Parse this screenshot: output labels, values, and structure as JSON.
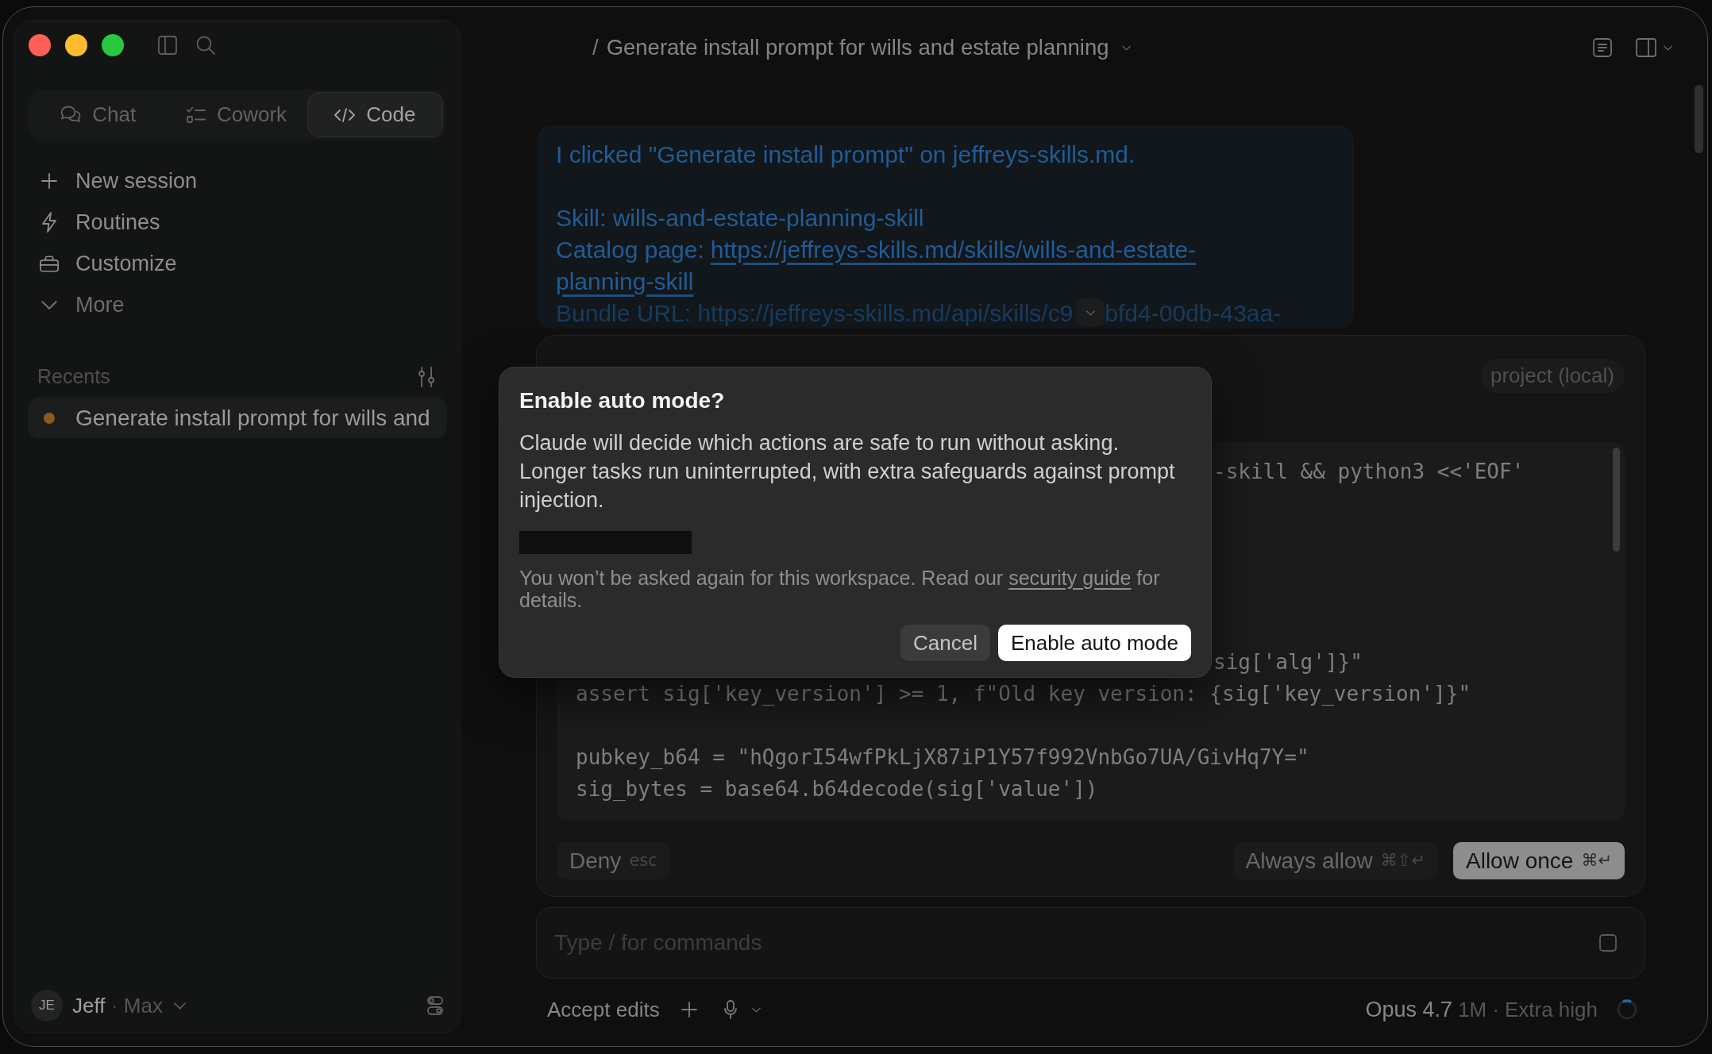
{
  "sidebar": {
    "mode_tabs": [
      {
        "label": "Chat",
        "selected": false
      },
      {
        "label": "Cowork",
        "selected": false
      },
      {
        "label": "Code",
        "selected": true
      }
    ],
    "nav": [
      "New session",
      "Routines",
      "Customize",
      "More"
    ],
    "recents_label": "Recents",
    "recents": [
      {
        "title": "Generate install prompt for wills and",
        "selected": true,
        "color": "#8c5a1e"
      }
    ],
    "user": {
      "initials": "JE",
      "name": "Jeff",
      "separator": "·",
      "plan": "Max"
    }
  },
  "header": {
    "separator": "/",
    "title": "Generate install prompt for wills and estate planning"
  },
  "message": {
    "intro": "I clicked \"Generate install prompt\" on jeffreys-skills.md.",
    "skill": "Skill: wills-and-estate-planning-skill",
    "catalog_label": "Catalog page:",
    "catalog_link": [
      "https://jeffreys-skills.md/skills/wills-and-estate-",
      "planning-skill"
    ],
    "bundle": [
      "Bundle URL: https://jeffreys-skills.md/api/skills/c9",
      "bfd4-00db-43aa-"
    ]
  },
  "permission": {
    "scope": "project (local)",
    "code_lines": [
      {
        "kind": "partial",
        "text": "-skill && python3 <<'EOF'"
      },
      {
        "kind": "blank"
      },
      {
        "kind": "blank"
      },
      {
        "kind": "blank"
      },
      {
        "kind": "blank"
      },
      {
        "kind": "blank"
      },
      {
        "kind": "partial",
        "text": "sig['alg']}\""
      },
      {
        "kind": "full",
        "text": "assert sig['key_version'] >= 1, f\"Old key version: {sig['key_version']}\""
      },
      {
        "kind": "blank"
      },
      {
        "kind": "full",
        "text": "pubkey_b64 = \"hQgorI54wfPkLjX87iP1Y57f992VnbGo7UA/GivHq7Y=\""
      },
      {
        "kind": "full",
        "text": "sig_bytes = base64.b64decode(sig['value'])"
      }
    ],
    "actions": [
      {
        "label": "Deny",
        "shortcut": "esc",
        "kind": "secondary"
      },
      {
        "label": "Always allow",
        "shortcut": "⌘⇧↵",
        "kind": "secondary"
      },
      {
        "label": "Allow once",
        "shortcut": "⌘↵",
        "kind": "primary"
      }
    ]
  },
  "composer": {
    "placeholder": "Type / for commands"
  },
  "status_bar": {
    "mode": "Accept edits",
    "model": "Opus 4.7",
    "context": "1M",
    "separator": "·",
    "effort": "Extra high"
  },
  "dialog": {
    "title": "Enable auto mode?",
    "body": [
      "Claude will decide which actions are safe to run without asking.",
      "Longer tasks run uninterrupted, with extra safeguards against prompt injection."
    ],
    "note": {
      "before": "You won’t be asked again for this workspace. Read our",
      "link": "security guide",
      "after": "for details."
    },
    "buttons": [
      {
        "label": "Cancel",
        "kind": "secondary"
      },
      {
        "label": "Enable auto mode",
        "kind": "primary"
      }
    ]
  }
}
